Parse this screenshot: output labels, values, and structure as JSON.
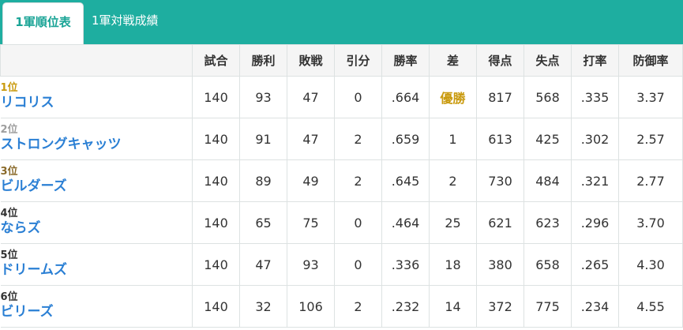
{
  "tabs": {
    "active": "1軍順位表",
    "inactive": "1軍対戦成績"
  },
  "colors": {
    "tab_bar": "#1eaea0",
    "rank1": "#c99a0e",
    "rank2": "#9e9e9e",
    "rank3": "#8a6a2a",
    "rank_default": "#333333",
    "team_link": "#2a7fd4"
  },
  "table": {
    "columns": [
      "試合",
      "勝利",
      "敗戦",
      "引分",
      "勝率",
      "差",
      "得点",
      "失点",
      "打率",
      "防御率"
    ],
    "rows": [
      {
        "rank": "1位",
        "team": "リコリス",
        "cells": [
          "140",
          "93",
          "47",
          "0",
          ".664",
          "優勝",
          "817",
          "568",
          ".335",
          "3.37"
        ]
      },
      {
        "rank": "2位",
        "team": "ストロングキャッツ",
        "cells": [
          "140",
          "91",
          "47",
          "2",
          ".659",
          "1",
          "613",
          "425",
          ".302",
          "2.57"
        ]
      },
      {
        "rank": "3位",
        "team": "ビルダーズ",
        "cells": [
          "140",
          "89",
          "49",
          "2",
          ".645",
          "2",
          "730",
          "484",
          ".321",
          "2.77"
        ]
      },
      {
        "rank": "4位",
        "team": "ならズ",
        "cells": [
          "140",
          "65",
          "75",
          "0",
          ".464",
          "25",
          "621",
          "623",
          ".296",
          "3.70"
        ]
      },
      {
        "rank": "5位",
        "team": "ドリームズ",
        "cells": [
          "140",
          "47",
          "93",
          "0",
          ".336",
          "18",
          "380",
          "658",
          ".265",
          "4.30"
        ]
      },
      {
        "rank": "6位",
        "team": "ビリーズ",
        "cells": [
          "140",
          "32",
          "106",
          "2",
          ".232",
          "14",
          "372",
          "775",
          ".234",
          "4.55"
        ]
      }
    ]
  }
}
